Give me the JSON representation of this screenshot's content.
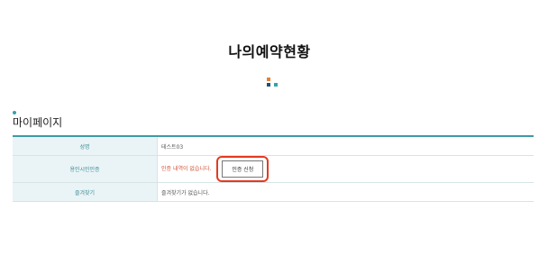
{
  "page": {
    "title": "나의예약현황"
  },
  "colors": {
    "accent": "#3d9aa6",
    "orange": "#e0823a",
    "navy": "#244d78",
    "teal": "#36a1ad",
    "highlight": "#e53a20",
    "notice": "#d2553a"
  },
  "section": {
    "title": "마이페이지"
  },
  "table": {
    "rows": [
      {
        "label": "성명",
        "value": "테스트03"
      },
      {
        "label": "용인시민인증",
        "value": "인증 내역이 없습니다.",
        "button": "인증 신청"
      },
      {
        "label": "즐겨찾기",
        "value": "즐겨찾기가 없습니다."
      }
    ]
  }
}
